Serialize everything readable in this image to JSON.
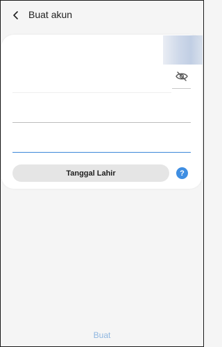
{
  "header": {
    "title": "Buat akun",
    "back_icon": "chevron-left-icon"
  },
  "form": {
    "password_toggle_icon": "eye-off-icon",
    "field_one": {
      "value": "",
      "placeholder": ""
    },
    "field_two": {
      "value": "",
      "placeholder": ""
    },
    "birthdate_button_label": "Tanggal Lahir",
    "help_label": "?"
  },
  "footer": {
    "create_button_label": "Buat"
  },
  "colors": {
    "background": "#f5f5f5",
    "card": "#ffffff",
    "accent": "#3f8ee2",
    "accent_muted": "#8fb6e0",
    "active_underline": "#3b87d8"
  }
}
